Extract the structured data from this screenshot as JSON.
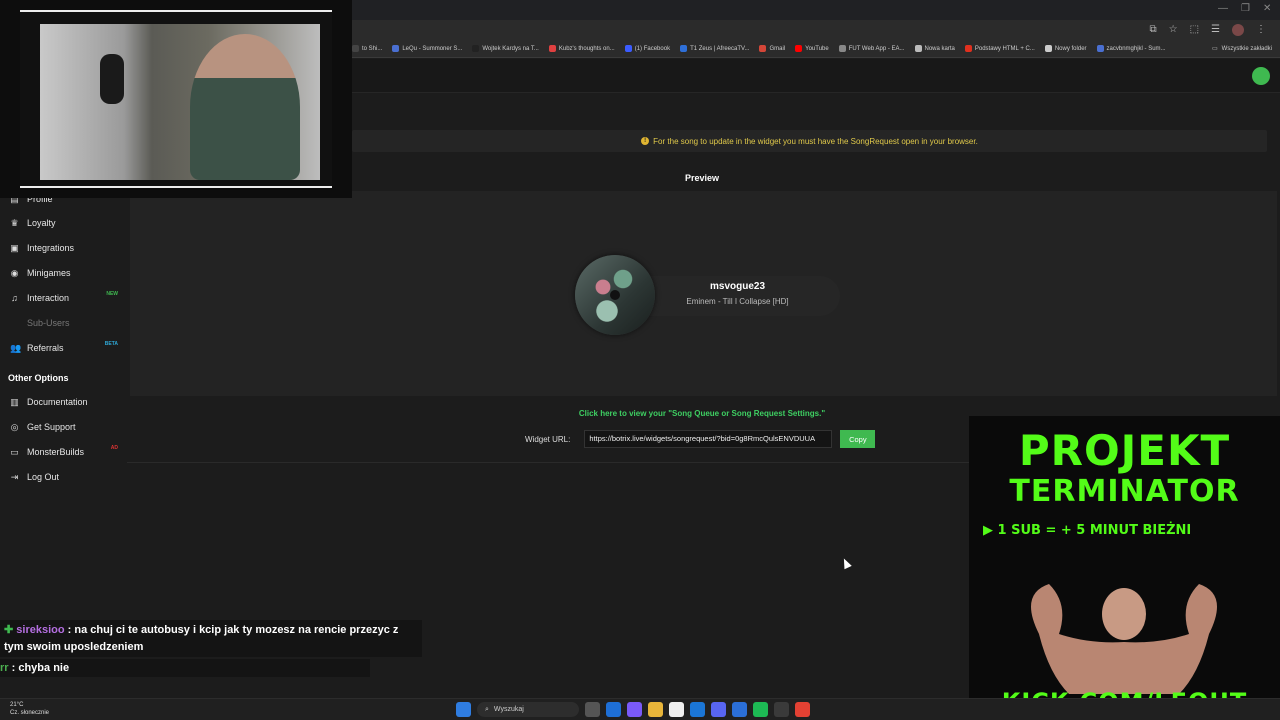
{
  "browser": {
    "bookmarks": [
      {
        "label": "to Shi...",
        "color": "#444"
      },
      {
        "label": "LeQu - Summoner S...",
        "color": "#4a6fd1"
      },
      {
        "label": "Wojtek Kardys na T...",
        "color": "#222"
      },
      {
        "label": "Kubz's thoughts on...",
        "color": "#e04040"
      },
      {
        "label": "(1) Facebook",
        "color": "#3b5cff"
      },
      {
        "label": "T1 Zeus | AfreecaTV...",
        "color": "#2e6fd8"
      },
      {
        "label": "Gmail",
        "color": "#d44638"
      },
      {
        "label": "YouTube",
        "color": "#ff0000"
      },
      {
        "label": "FUT Web App - EA...",
        "color": "#888"
      },
      {
        "label": "Nowa karta",
        "color": "#bbb"
      },
      {
        "label": "Podstawy HTML + C...",
        "color": "#e0301e"
      },
      {
        "label": "Nowy folder",
        "color": "#ccc"
      },
      {
        "label": "zacvbnmghjkl - Sum...",
        "color": "#4a6fd1"
      }
    ],
    "all_bookmarks": "Wszystkie zakładki"
  },
  "sidebar": {
    "items": [
      {
        "label": "Profile",
        "icon": "id-card-icon"
      },
      {
        "label": "Loyalty",
        "icon": "trophy-icon"
      },
      {
        "label": "Integrations",
        "icon": "plug-icon"
      },
      {
        "label": "Minigames",
        "icon": "gamepad-icon"
      },
      {
        "label": "Interaction",
        "icon": "music-icon",
        "badge": "NEW"
      },
      {
        "label": "Sub-Users",
        "icon": "user-icon"
      },
      {
        "label": "Referrals",
        "icon": "users-icon",
        "badge": "BETA"
      }
    ],
    "other_title": "Other Options",
    "other_items": [
      {
        "label": "Documentation",
        "icon": "book-icon"
      },
      {
        "label": "Get Support",
        "icon": "support-icon"
      },
      {
        "label": "MonsterBuilds",
        "icon": "monitor-icon",
        "badge": "AD"
      },
      {
        "label": "Log Out",
        "icon": "logout-icon"
      }
    ]
  },
  "main": {
    "notice": "For the song to update in the widget you must have the SongRequest open in your browser.",
    "preview_label": "Preview",
    "widget": {
      "username": "msvogue23",
      "song": "Eminem - Till I Collapse [HD]"
    },
    "settings_link": "Click here to view your \"Song Queue or Song Request Settings.\"",
    "url_label": "Widget URL:",
    "url_value": "https://botrix.live/widgets/songrequest/?bid=0g8RmcQulsENVDUUA",
    "copy_label": "Copy"
  },
  "promo": {
    "title1": "PROJEKT",
    "title2": "TERMINATOR",
    "subtitle": "▶  1 SUB = + 5 MINUT BIEŻNI",
    "url": "KICK.COM/LEQUT"
  },
  "chat": [
    {
      "user": "sireksioo",
      "text": ": na chuj ci te autobusy i kcip jak ty mozesz na rencie przezyc z tym swoim uposledzeniem"
    },
    {
      "user": "rr",
      "text": ": chyba nie"
    }
  ],
  "taskbar": {
    "temp": "21°C",
    "weather": "Cz. słonecznie",
    "search": "Wyszukaj"
  },
  "colors": {
    "accent": "#3fb950",
    "kick_green": "#53fc18",
    "notice": "#e0c94a"
  }
}
